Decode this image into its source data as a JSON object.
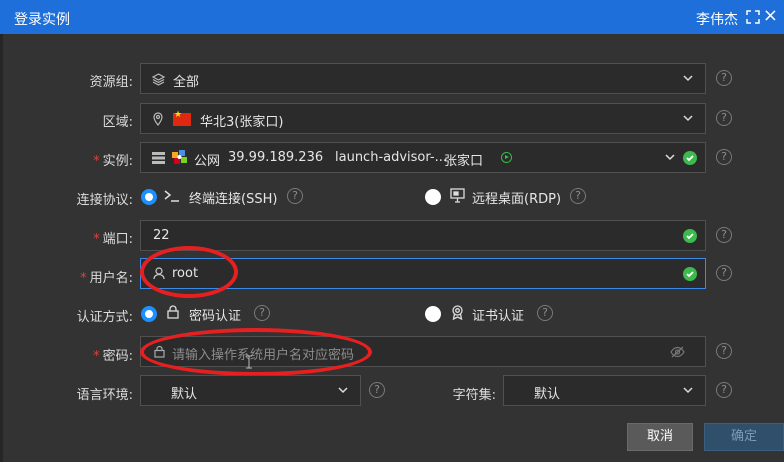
{
  "window": {
    "title": "登录实例",
    "user": "李伟杰",
    "close": "×"
  },
  "form": {
    "resource_group": {
      "label": "资源组:",
      "value": "全部"
    },
    "region": {
      "label": "区域:",
      "value": "华北3(张家口)"
    },
    "instance": {
      "label": "实例:",
      "network": "公网",
      "ip": "39.99.189.236",
      "name": "launch-advisor-...",
      "zone": "张家口"
    },
    "protocol": {
      "label": "连接协议:",
      "options": [
        {
          "label": "终端连接(SSH)",
          "selected": true
        },
        {
          "label": "远程桌面(RDP)",
          "selected": false
        }
      ]
    },
    "port": {
      "label": "端口:",
      "value": "22"
    },
    "username": {
      "label": "用户名:",
      "value": "root"
    },
    "auth": {
      "label": "认证方式:",
      "options": [
        {
          "label": "密码认证",
          "selected": true
        },
        {
          "label": "证书认证",
          "selected": false
        }
      ]
    },
    "password": {
      "label": "密码:",
      "placeholder": "请输入操作系统用户名对应密码"
    },
    "locale": {
      "label": "语言环境:",
      "value": "默认"
    },
    "charset": {
      "label": "字符集:",
      "value": "默认"
    }
  },
  "buttons": {
    "cancel": "取消",
    "confirm": "确定"
  },
  "help_glyph": "?",
  "required_mark": "*",
  "colors": {
    "titlebar": "#1e6fd9",
    "accent": "#1e8fff",
    "success": "#3dba4e",
    "required": "#e0403a",
    "annotation": "#e62020"
  }
}
